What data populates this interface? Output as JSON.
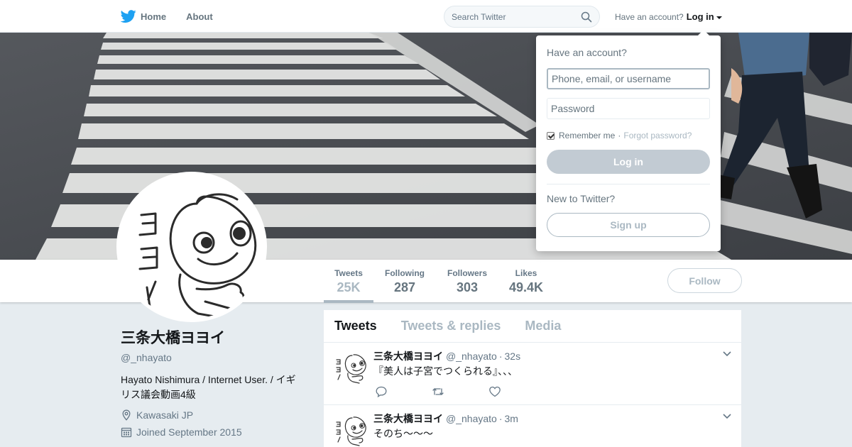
{
  "nav": {
    "home_label": "Home",
    "about_label": "About",
    "search_placeholder": "Search Twitter",
    "account_prompt": "Have an account?",
    "login_label": "Log in"
  },
  "login_dropdown": {
    "title": "Have an account?",
    "username_placeholder": "Phone, email, or username",
    "password_placeholder": "Password",
    "remember_label": "Remember me",
    "separator": "·",
    "forgot_label": "Forgot password?",
    "login_button": "Log in",
    "new_prompt": "New to Twitter?",
    "signup_button": "Sign up"
  },
  "profile": {
    "name": "三条大橋ヨヨイ",
    "handle": "@_nhayato",
    "bio": "Hayato Nishimura / Internet User. / イギリス議会動画4級",
    "location": "Kawasaki JP",
    "joined": "Joined September 2015",
    "follow_label": "Follow"
  },
  "stats": [
    {
      "label": "Tweets",
      "value": "25K"
    },
    {
      "label": "Following",
      "value": "287"
    },
    {
      "label": "Followers",
      "value": "303"
    },
    {
      "label": "Likes",
      "value": "49.4K"
    }
  ],
  "tabs": [
    "Tweets",
    "Tweets & replies",
    "Media"
  ],
  "tweets": [
    {
      "name": "三条大橋ヨヨイ",
      "handle": "@_nhayato",
      "dot": "·",
      "time": "32s",
      "text": "『美人は子宮でつくられる』、、、"
    },
    {
      "name": "三条大橋ヨヨイ",
      "handle": "@_nhayato",
      "dot": "·",
      "time": "3m",
      "text": "そのち〜〜〜"
    }
  ],
  "colors": {
    "brand": "#1da1f2",
    "muted": "#657786",
    "banner": "#4a4d52"
  }
}
